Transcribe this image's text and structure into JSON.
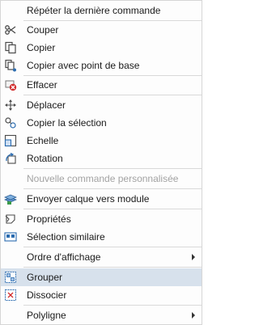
{
  "menu": {
    "items": [
      {
        "label": "Répéter la dernière commande",
        "icon": "none"
      },
      {
        "label": "Couper",
        "icon": "scissors-icon"
      },
      {
        "label": "Copier",
        "icon": "copy-icon"
      },
      {
        "label": "Copier avec point de base",
        "icon": "copy-base-point-icon"
      },
      {
        "label": "Effacer",
        "icon": "erase-icon"
      },
      {
        "label": "Déplacer",
        "icon": "move-icon"
      },
      {
        "label": "Copier la sélection",
        "icon": "copy-selection-icon"
      },
      {
        "label": "Echelle",
        "icon": "scale-icon"
      },
      {
        "label": "Rotation",
        "icon": "rotate-icon"
      },
      {
        "label": "Nouvelle commande personnalisée",
        "icon": "none",
        "disabled": true
      },
      {
        "label": "Envoyer calque vers module",
        "icon": "layer-send-icon"
      },
      {
        "label": "Propriétés",
        "icon": "properties-icon"
      },
      {
        "label": "Sélection similaire",
        "icon": "select-similar-icon"
      },
      {
        "label": "Ordre d'affichage",
        "icon": "none",
        "submenu": true
      },
      {
        "label": "Grouper",
        "icon": "group-icon",
        "highlighted": true
      },
      {
        "label": "Dissocier",
        "icon": "ungroup-icon"
      },
      {
        "label": "Polyligne",
        "icon": "none",
        "submenu": true
      }
    ]
  },
  "colors": {
    "highlight": "#d7e1ec",
    "disabled_text": "#a3a3a3",
    "separator": "#d9d9d9",
    "accent_blue": "#2b6cb0",
    "accent_red": "#d12b2b"
  }
}
